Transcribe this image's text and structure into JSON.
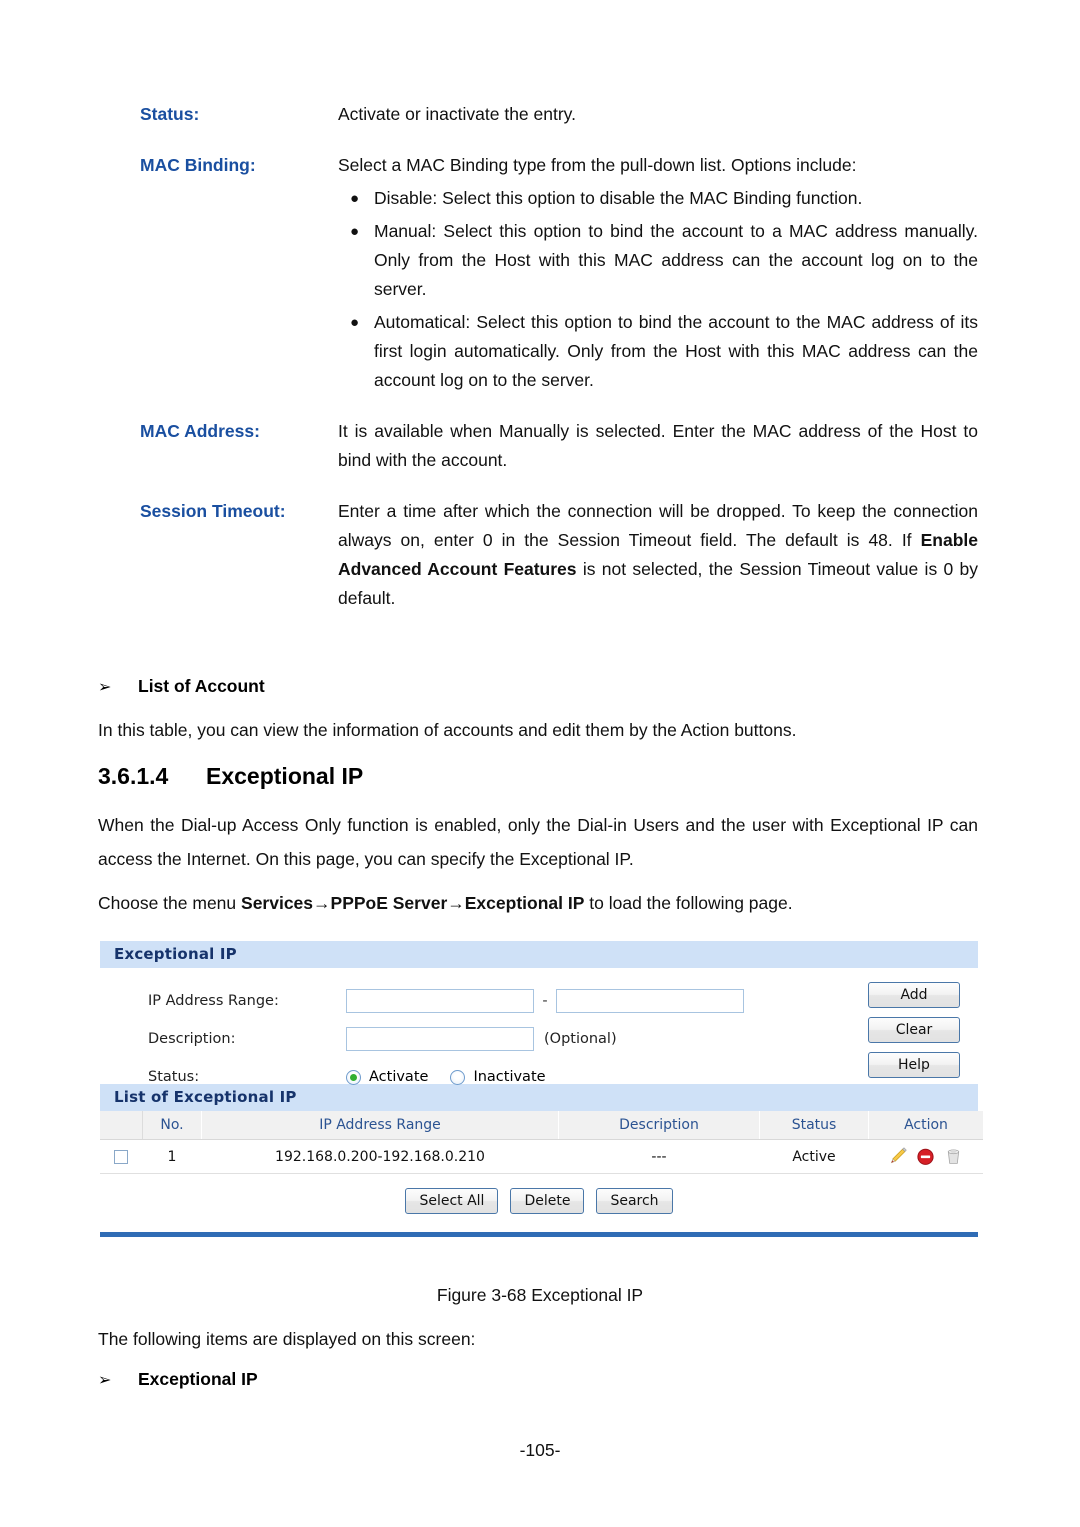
{
  "document": {
    "page_number": "-105-",
    "figure_caption": "Figure 3-68 Exceptional IP",
    "section_heading": {
      "number": "3.6.1.4",
      "title": "Exceptional IP"
    },
    "definitions": [
      {
        "term": "Status:",
        "body": "Activate or inactivate the entry."
      },
      {
        "term": "MAC Binding:",
        "body": "Select a MAC Binding type from the pull-down list. Options include:",
        "bullets": [
          "Disable: Select this option to disable the MAC Binding function.",
          "Manual: Select this option to bind the account to a MAC address manually. Only from the Host with this MAC address can the account log on to the server.",
          "Automatical: Select this option to bind the account to the MAC address of its first login automatically. Only from the Host with this MAC address can the account log on to the server."
        ]
      },
      {
        "term": "MAC Address:",
        "body": "It is available when Manually is selected. Enter the MAC address of the Host to bind with the account."
      },
      {
        "term": "Session Timeout:",
        "body_part1": "Enter a time after which the connection will be dropped. To keep the connection always on, enter 0 in the Session Timeout field. The default is 48. If ",
        "body_bold": "Enable Advanced Account Features",
        "body_part2": " is not selected, the Session Timeout value is 0 by default."
      }
    ],
    "list_of_account_heading": "List of Account",
    "list_of_account_text": "In this table, you can view the information of accounts and edit them by the Action buttons.",
    "intro_paragraph": "When the Dial-up Access Only function is enabled, only the Dial-in Users and the user with Exceptional IP can access the Internet. On this page, you can specify the Exceptional IP.",
    "menu_paragraph": {
      "prefix": "Choose the menu ",
      "path": "Services→PPPoE Server→Exceptional IP",
      "suffix": " to load the following page."
    },
    "following_items_text": "The following items are displayed on this screen:",
    "exceptional_ip_heading": "Exceptional IP",
    "arrow_glyph": "➢",
    "bullet_glyph": "●"
  },
  "ui": {
    "panel_title": "Exceptional IP",
    "form": {
      "ip_range_label": "IP Address Range:",
      "ip_range_start_value": "",
      "ip_range_end_value": "",
      "range_separator": "-",
      "description_label": "Description:",
      "description_value": "",
      "description_hint": "(Optional)",
      "status_label": "Status:",
      "status_activate_label": "Activate",
      "status_inactivate_label": "Inactivate",
      "status_selected": "Activate"
    },
    "side_buttons": [
      {
        "label": "Add",
        "name": "add-button"
      },
      {
        "label": "Clear",
        "name": "clear-button"
      },
      {
        "label": "Help",
        "name": "help-button"
      }
    ],
    "list_title": "List of Exceptional IP",
    "table": {
      "columns": [
        "",
        "No.",
        "IP Address Range",
        "Description",
        "Status",
        "Action"
      ],
      "rows": [
        {
          "checked": false,
          "no": "1",
          "ip_range": "192.168.0.200-192.168.0.210",
          "description": "---",
          "status": "Active",
          "actions": [
            "edit-icon",
            "disable-icon",
            "delete-icon"
          ]
        }
      ]
    },
    "bottom_buttons": [
      {
        "label": "Select All",
        "name": "select-all-button"
      },
      {
        "label": "Delete",
        "name": "delete-button"
      },
      {
        "label": "Search",
        "name": "search-button"
      }
    ],
    "colors": {
      "panel_header_bg": "#cfe1f7",
      "panel_header_text": "#16336b",
      "panel_bottom_rule": "#2f6cb5",
      "table_header_bg": "#f1f1f1",
      "table_header_text": "#2b5392",
      "radio_selected": "#32b032",
      "term_color": "#1a4fa0"
    }
  }
}
